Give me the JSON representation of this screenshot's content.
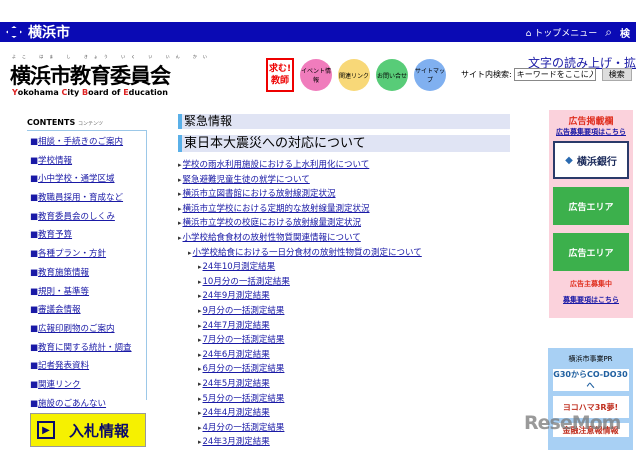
{
  "topbar": {
    "city": "横浜市",
    "top_menu": "トップメニュー",
    "search_short": "検"
  },
  "header": {
    "title": "横浜市教育委員会",
    "ruby": "よこ はま し きょう いく い いん かい",
    "en_parts": [
      "Y",
      "okohama ",
      "C",
      "ity ",
      "B",
      "oard ",
      "of ",
      "E",
      "ducation"
    ],
    "icons": [
      {
        "label": "求む!教師",
        "color": "#ffffff"
      },
      {
        "label": "イベント情報",
        "color": "#f07cbc"
      },
      {
        "label": "関連リンク",
        "color": "#f8d878"
      },
      {
        "label": "お問い合せ",
        "color": "#58cc78"
      },
      {
        "label": "サイトマップ",
        "color": "#80b0f0"
      }
    ],
    "readout": "文字の読み上げ・拡大",
    "search_label": "サイト内検索:",
    "search_placeholder": "キーワードをここに入力",
    "search_button": "検索"
  },
  "nav": {
    "heading": "CONTENTS",
    "heading_kana": "コンテンツ",
    "items": [
      "相談・手続きのご案内",
      "学校情報",
      "小中学校・通学区域",
      "教職員採用・育成など",
      "教育委員会のしくみ",
      "教育予算",
      "各種プラン・方針",
      "教育施策情報",
      "規則・基準等",
      "審議会情報",
      "広報印刷物のご案内",
      "教育に関する統計・調査",
      "記者発表資料",
      "関連リンク",
      "施設のごあんない"
    ],
    "bid": "入札情報"
  },
  "main": {
    "emergency": "緊急情報",
    "earthquake": "東日本大震災への対応について",
    "links": [
      {
        "level": 1,
        "text": "学校の雨水利用施設における上水利用化について"
      },
      {
        "level": 1,
        "text": "緊急避難児童生徒の就学について"
      },
      {
        "level": 1,
        "text": "横浜市立図書館における放射線測定状況"
      },
      {
        "level": 1,
        "text": "横浜市立学校における定期的な放射線量測定状況"
      },
      {
        "level": 1,
        "text": "横浜市立学校の校庭における放射線量測定状況"
      },
      {
        "level": 1,
        "text": "小学校給食食材の放射性物質関連情報について"
      },
      {
        "level": 2,
        "text": "小学校給食における一日分食材の放射性物質の測定について"
      },
      {
        "level": 3,
        "text": "24年10月測定結果"
      },
      {
        "level": 3,
        "text": "10月分の一括測定結果"
      },
      {
        "level": 3,
        "text": "24年9月測定結果"
      },
      {
        "level": 3,
        "text": "9月分の一括測定結果"
      },
      {
        "level": 3,
        "text": "24年7月測定結果"
      },
      {
        "level": 3,
        "text": "7月分の一括測定結果"
      },
      {
        "level": 3,
        "text": "24年6月測定結果"
      },
      {
        "level": 3,
        "text": "6月分の一括測定結果"
      },
      {
        "level": 3,
        "text": "24年5月測定結果"
      },
      {
        "level": 3,
        "text": "5月分の一括測定結果"
      },
      {
        "level": 3,
        "text": "24年4月測定結果"
      },
      {
        "level": 3,
        "text": "4月分の一括測定結果"
      },
      {
        "level": 3,
        "text": "24年3月測定結果"
      }
    ]
  },
  "ads": {
    "title": "広告掲載欄",
    "recruit_link": "広告募集要項はこちら",
    "bank": "横浜銀行",
    "area1": "広告エリア",
    "area2": "広告エリア",
    "wanted": "広告主募集中",
    "wanted_link": "募集要項はこちら"
  },
  "pr": {
    "title": "横浜市事業PR",
    "banner1": "G30からCO-DO30へ",
    "banner2": "ヨコハマ3R夢!",
    "banner3": "金融注意報情報"
  },
  "watermark": "ReseMom"
}
